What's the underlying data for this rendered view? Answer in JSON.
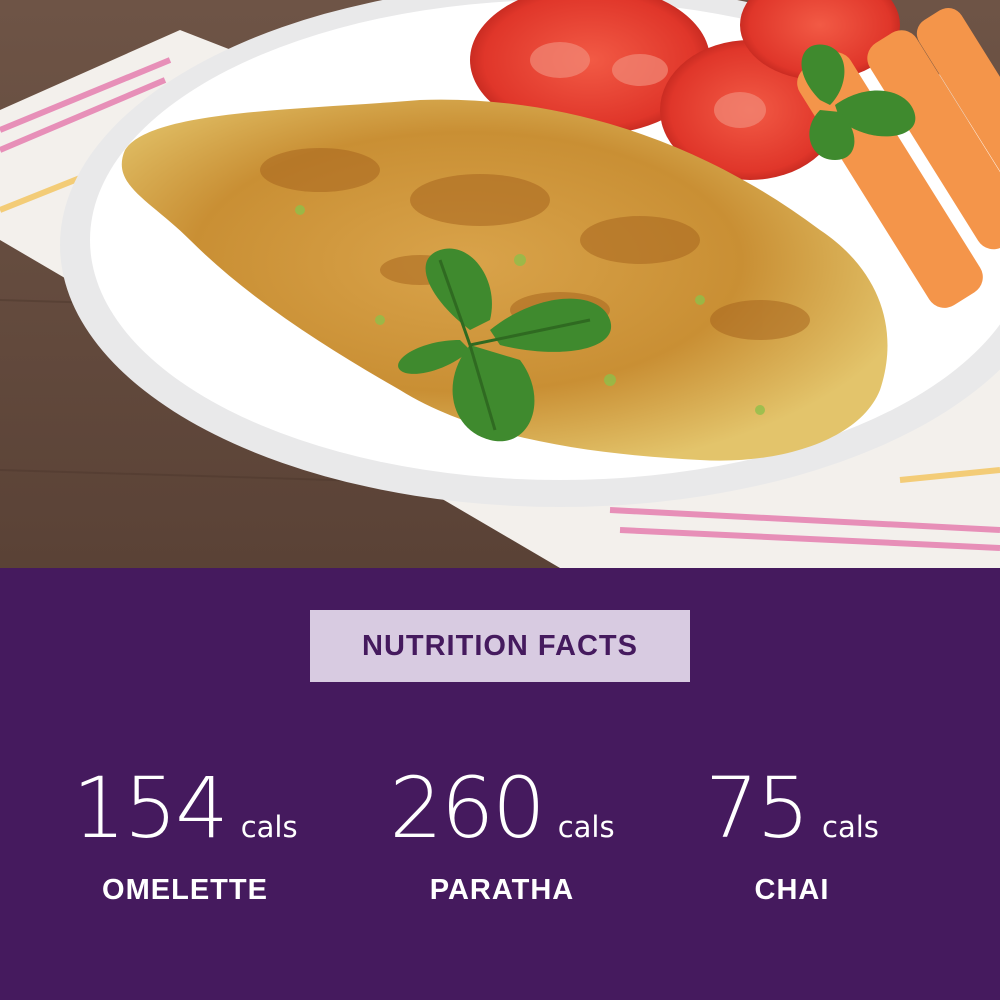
{
  "badge": {
    "label": "NUTRITION FACTS"
  },
  "stats": [
    {
      "value": "154",
      "unit": "cals",
      "name": "OMELETTE"
    },
    {
      "value": "260",
      "unit": "cals",
      "name": "PARATHA"
    },
    {
      "value": "75",
      "unit": "cals",
      "name": "CHAI"
    }
  ],
  "colors": {
    "panel": "#451a5e",
    "badge_bg": "#d8cbe1",
    "badge_text": "#451a5e",
    "text": "#ffffff"
  }
}
